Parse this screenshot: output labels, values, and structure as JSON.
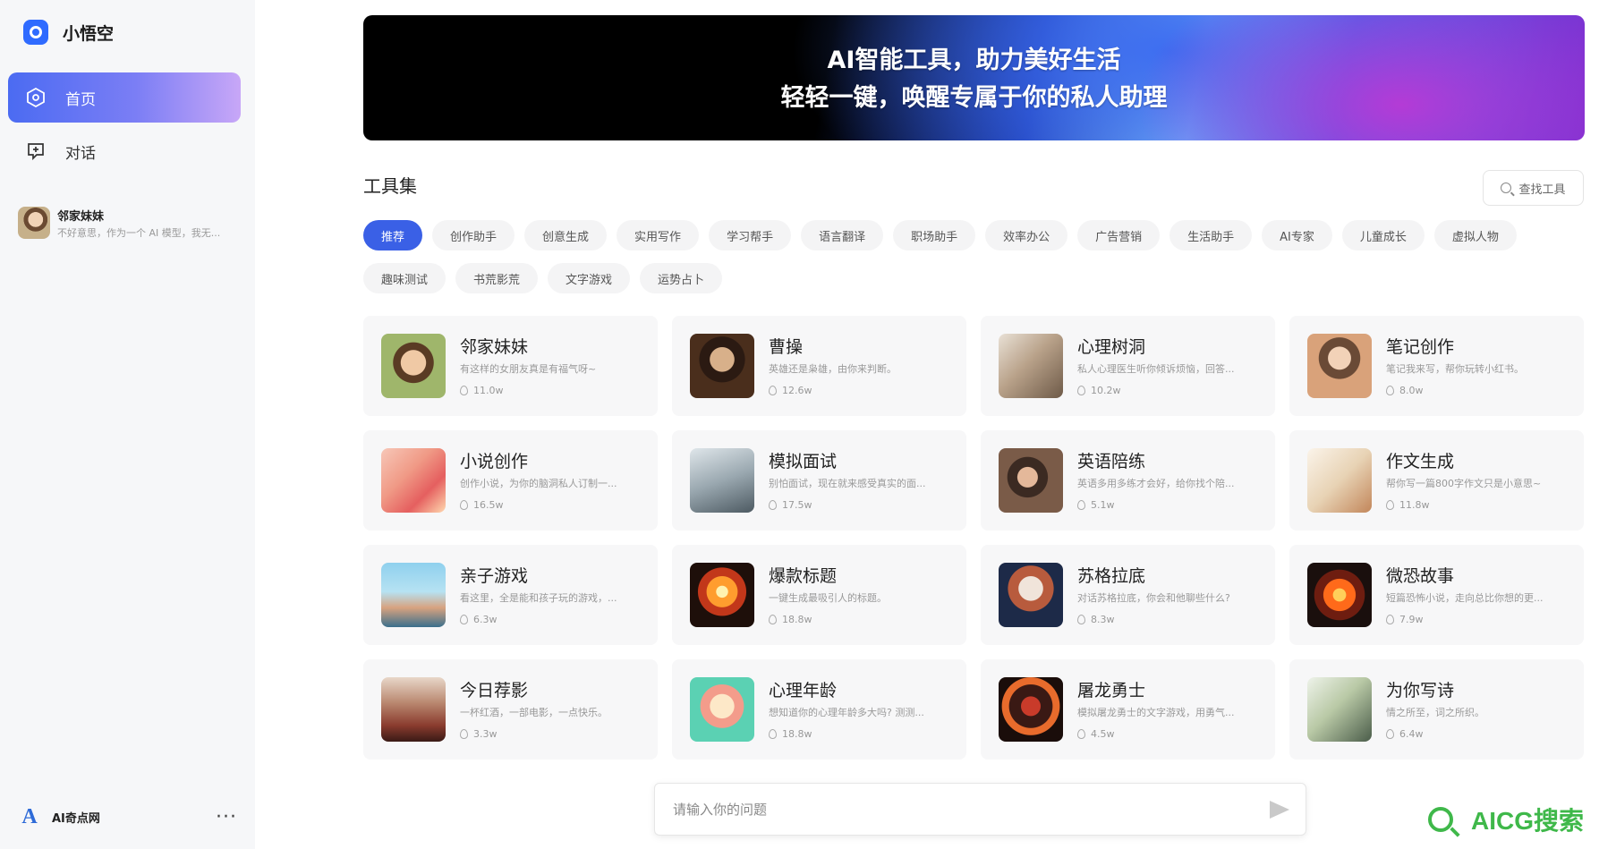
{
  "app": {
    "name": "小悟空",
    "accent": "#3a60e6"
  },
  "nav": [
    {
      "label": "首页",
      "icon": "home-icon",
      "active": true
    },
    {
      "label": "对话",
      "icon": "chat-icon",
      "active": false
    }
  ],
  "history": [
    {
      "name": "邻家妹妹",
      "preview": "不好意思，作为一个 AI 模型，我无..."
    }
  ],
  "user": {
    "name": "AI奇点网"
  },
  "banner": {
    "line1": "AI智能工具，助力美好生活",
    "line2": "轻轻一键，唤醒专属于你的私人助理"
  },
  "toolset": {
    "title": "工具集",
    "search_label": "查找工具",
    "categories": [
      "推荐",
      "创作助手",
      "创意生成",
      "实用写作",
      "学习帮手",
      "语言翻译",
      "职场助手",
      "效率办公",
      "广告营销",
      "生活助手",
      "AI专家",
      "儿童成长",
      "虚拟人物",
      "趣味测试",
      "书荒影荒",
      "文字游戏",
      "运势占卜"
    ],
    "active_category": "推荐"
  },
  "cards": [
    {
      "title": "邻家妹妹",
      "desc": "有这样的女朋友真是有福气呀~",
      "count": "11.0w"
    },
    {
      "title": "曹操",
      "desc": "英雄还是枭雄，由你来判断。",
      "count": "12.6w"
    },
    {
      "title": "心理树洞",
      "desc": "私人心理医生听你倾诉烦恼，回答...",
      "count": "10.2w"
    },
    {
      "title": "笔记创作",
      "desc": "笔记我来写，帮你玩转小红书。",
      "count": "8.0w"
    },
    {
      "title": "小说创作",
      "desc": "创作小说，为你的脑洞私人订制一...",
      "count": "16.5w"
    },
    {
      "title": "模拟面试",
      "desc": "别怕面试，现在就来感受真实的面...",
      "count": "17.5w"
    },
    {
      "title": "英语陪练",
      "desc": "英语多用多练才会好，给你找个陪...",
      "count": "5.1w"
    },
    {
      "title": "作文生成",
      "desc": "帮你写一篇800字作文只是小意思~",
      "count": "11.8w"
    },
    {
      "title": "亲子游戏",
      "desc": "看这里，全是能和孩子玩的游戏，...",
      "count": "6.3w"
    },
    {
      "title": "爆款标题",
      "desc": "一键生成最吸引人的标题。",
      "count": "18.8w"
    },
    {
      "title": "苏格拉底",
      "desc": "对话苏格拉底，你会和他聊些什么?",
      "count": "8.3w"
    },
    {
      "title": "微恐故事",
      "desc": "短篇恐怖小说，走向总比你想的更...",
      "count": "7.9w"
    },
    {
      "title": "今日荐影",
      "desc": "一杯红酒，一部电影，一点快乐。",
      "count": "3.3w"
    },
    {
      "title": "心理年龄",
      "desc": "想知道你的心理年龄多大吗? 测测...",
      "count": "18.8w"
    },
    {
      "title": "屠龙勇士",
      "desc": "模拟屠龙勇士的文字游戏，用勇气...",
      "count": "4.5w"
    },
    {
      "title": "为你写诗",
      "desc": "情之所至，词之所织。",
      "count": "6.4w"
    }
  ],
  "input": {
    "placeholder": "请输入你的问题"
  },
  "watermark": {
    "text": "AICG搜索"
  }
}
